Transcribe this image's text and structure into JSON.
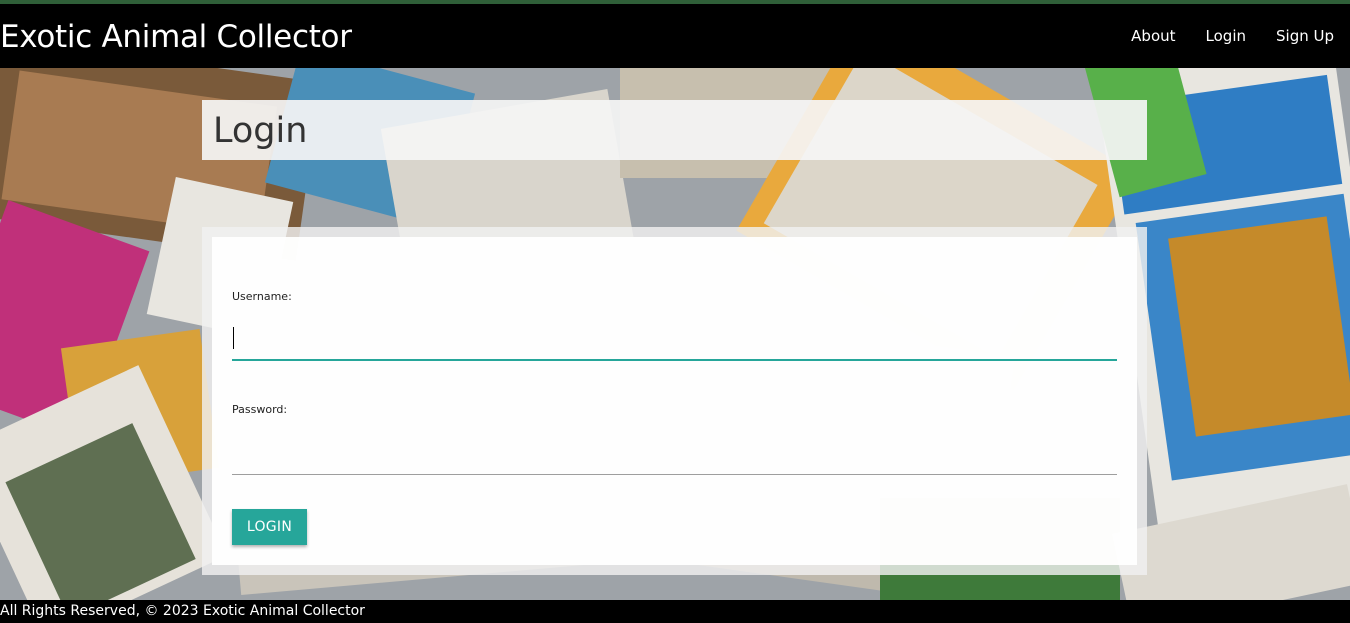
{
  "navbar": {
    "brand": "Exotic Animal Collector",
    "links": [
      "About",
      "Login",
      "Sign Up"
    ]
  },
  "page": {
    "title": "Login"
  },
  "form": {
    "username_label": "Username:",
    "username_value": "",
    "password_label": "Password:",
    "password_value": "",
    "submit_label": "LOGIN"
  },
  "footer": {
    "text": "All Rights Reserved, © 2023 Exotic Animal Collector"
  },
  "colors": {
    "accent": "#26a69a",
    "navbar": "#000000",
    "top_strip": "#2f5f38"
  }
}
